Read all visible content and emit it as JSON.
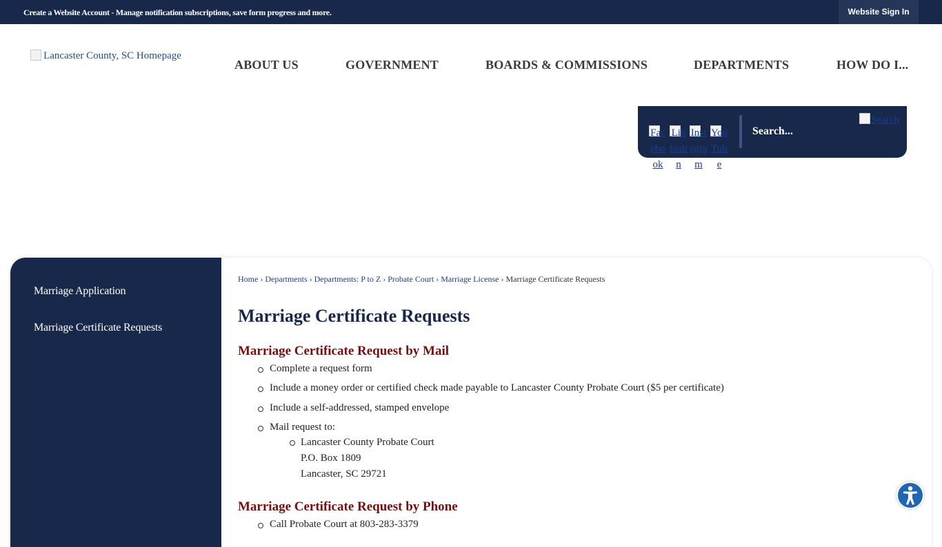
{
  "topbar": {
    "message": "Create a Website Account - Manage notification subscriptions, save form progress and more.",
    "sign_in": "Website Sign In"
  },
  "logo": {
    "alt": "Lancaster County, SC Homepage"
  },
  "nav": [
    {
      "label": "ABOUT US"
    },
    {
      "label": "GOVERNMENT"
    },
    {
      "label": "BOARDS & COMMISSIONS"
    },
    {
      "label": "DEPARTMENTS"
    },
    {
      "label": "HOW DO I..."
    }
  ],
  "social": [
    {
      "label": "Facebook",
      "wrapped": "Fac\nebo\nok",
      "icon": "facebook-icon"
    },
    {
      "label": "Linkedin",
      "wrapped": "Lin\nked\nin",
      "icon": "linkedin-icon"
    },
    {
      "label": "Instagram",
      "wrapped": "Inst\nagr\nam",
      "icon": "instagram-icon"
    },
    {
      "label": "YouTube",
      "wrapped": "Yo\nuTu\nbe",
      "icon": "youtube-icon"
    }
  ],
  "search": {
    "placeholder": "Search...",
    "button_alt": "Search"
  },
  "sidebar": {
    "items": [
      {
        "label": "Marriage Application"
      },
      {
        "label": "Marriage Certificate Requests"
      }
    ]
  },
  "breadcrumb": {
    "links": [
      "Home",
      "Departments",
      "Departments: P to Z",
      "Probate Court",
      "Marriage License"
    ],
    "current": "Marriage Certificate Requests",
    "separator": "›"
  },
  "content": {
    "title": "Marriage Certificate Requests",
    "mail": {
      "heading": "Marriage Certificate Request by Mail",
      "bullets": [
        "Complete a request form",
        "Include a money order or certified check made payable to Lancaster County Probate Court ($5 per certificate)",
        "Include a self-addressed, stamped envelope",
        "Mail request to:"
      ],
      "address": [
        "Lancaster County Probate Court",
        "P.O. Box 1809",
        "Lancaster, SC 29721"
      ]
    },
    "phone": {
      "heading": "Marriage Certificate Request by Phone",
      "bullets": [
        "Call Probate Court at 803-283-3379"
      ]
    }
  },
  "colors": {
    "navy": "#17284b",
    "section_heading": "#7a0d0d",
    "link": "#1a3d8f",
    "a11y": "#1f67b3"
  }
}
